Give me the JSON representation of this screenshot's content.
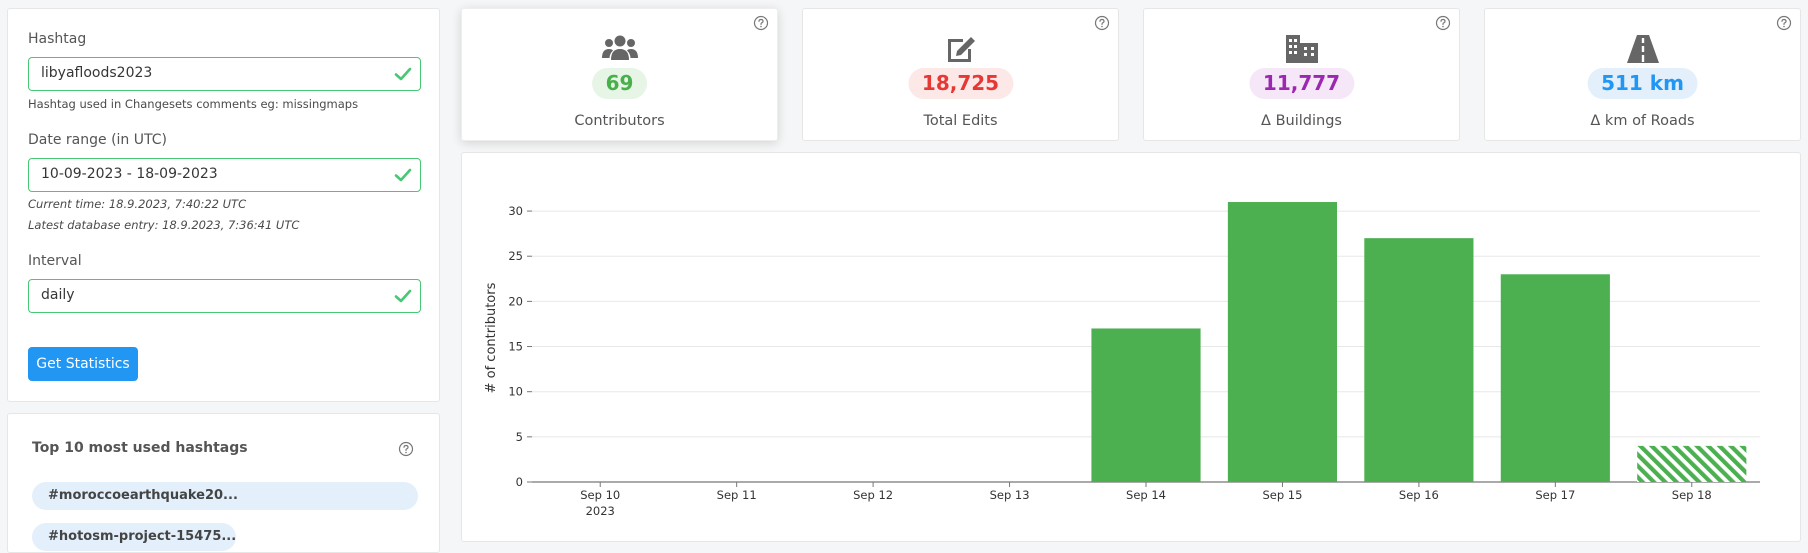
{
  "form": {
    "hashtag_label": "Hashtag",
    "hashtag_value": "libyafloods2023",
    "hashtag_help": "Hashtag used in Changesets comments eg: missingmaps",
    "date_label": "Date range (in UTC)",
    "date_value": "10-09-2023 - 18-09-2023",
    "current_time": "Current time: 18.9.2023, 7:40:22 UTC",
    "latest_entry": "Latest database entry: 18.9.2023, 7:36:41 UTC",
    "interval_label": "Interval",
    "interval_value": "daily",
    "submit_label": "Get Statistics",
    "valid_color": "#48c774",
    "button_color": "#2196f3"
  },
  "hashtags": {
    "title": "Top 10 most used hashtags",
    "items": [
      "#moroccoearthquake20...",
      "#hotosm-project-15475..."
    ]
  },
  "stats": [
    {
      "value": "69",
      "label": "Contributors",
      "icon": "users-icon",
      "color": "#48b04a",
      "bg": "#e6f5e6"
    },
    {
      "value": "18,725",
      "label": "Total Edits",
      "icon": "edit-icon",
      "color": "#e53935",
      "bg": "#fde8e8"
    },
    {
      "value": "11,777",
      "label": "Δ Buildings",
      "icon": "buildings-icon",
      "color": "#9c27b0",
      "bg": "#f5e6f8"
    },
    {
      "value": "511 km",
      "label": "Δ km of Roads",
      "icon": "road-icon",
      "color": "#2196f3",
      "bg": "#e3f0fc"
    }
  ],
  "chart_data": {
    "type": "bar",
    "categories": [
      "Sep 10",
      "Sep 11",
      "Sep 12",
      "Sep 13",
      "Sep 14",
      "Sep 15",
      "Sep 16",
      "Sep 17",
      "Sep 18"
    ],
    "year_label": "2023",
    "values": [
      0,
      0,
      0,
      0,
      17,
      31,
      27,
      23,
      4
    ],
    "partial_last": true,
    "ylabel": "# of contributors",
    "yticks": [
      0,
      5,
      10,
      15,
      20,
      25,
      30
    ],
    "ylim": [
      0,
      32
    ],
    "grid": true,
    "bar_color": "#4caf50"
  }
}
